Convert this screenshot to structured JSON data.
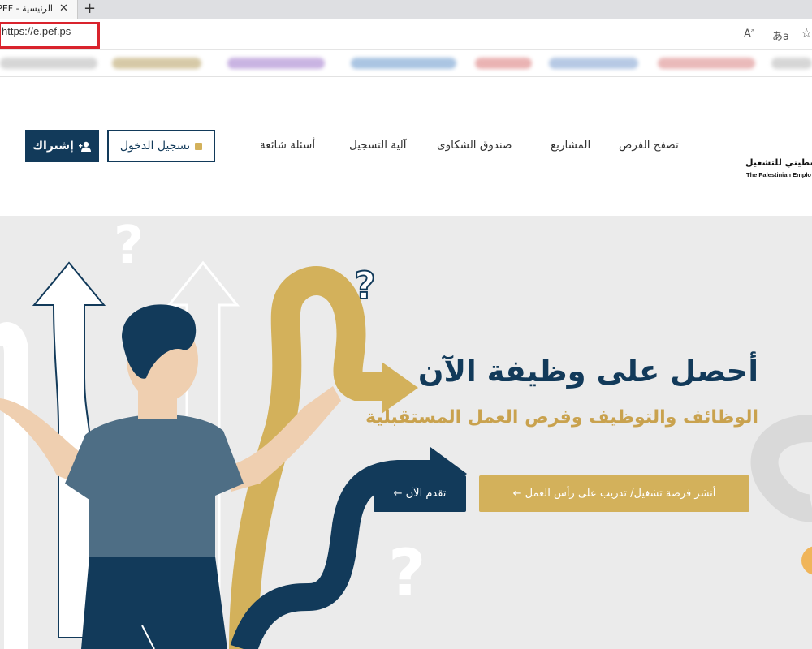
{
  "browser": {
    "tab_title": "الرئيسية - PEF",
    "tab_close": "✕",
    "new_tab": "+",
    "url": "https://e.pef.ps",
    "read_aloud_icon": "Aᵃ",
    "immersive_icon": "あa",
    "favorite_icon": "☆"
  },
  "header": {
    "subscribe_label": "إشتراك",
    "login_label": "تسجيل الدخول",
    "nav": [
      {
        "label": "تصفح الفرص"
      },
      {
        "label": "المشاريع"
      },
      {
        "label": "صندوق الشكاوى"
      },
      {
        "label": "آلية التسجيل"
      },
      {
        "label": "أسئلة شائعة"
      }
    ],
    "logo_ar": "الفلسطيني للتشغيل",
    "logo_en": "The Palestinian Emplo"
  },
  "hero": {
    "title": "أحصل على وظيفة الآن",
    "subtitle": "الوظائف والتوظيف وفرص العمل المستقبلية",
    "post_button": "أنشر فرصة تشغيل/ تدريب على رأس العمل ←",
    "apply_button": "تقدم الآن ←"
  },
  "colors": {
    "navy": "#123a5a",
    "gold": "#d3b15b",
    "hero_bg": "#ebebeb",
    "url_highlight": "#d9232d"
  }
}
